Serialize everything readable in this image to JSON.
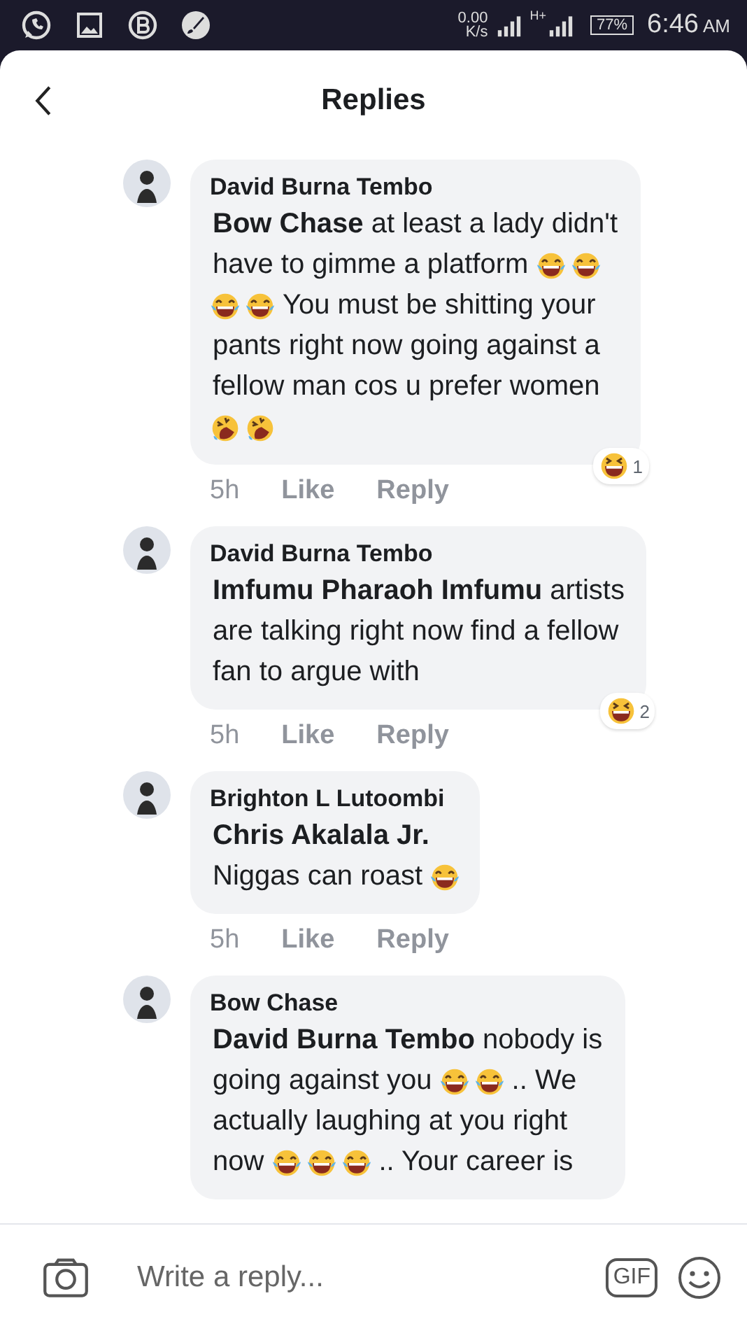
{
  "status_bar": {
    "speed": "0.00",
    "speed_unit": "K/s",
    "network": "H+",
    "battery": "77%",
    "time": "6:46",
    "ampm": "AM"
  },
  "header": {
    "title": "Replies"
  },
  "comments": [
    {
      "author": "David Burna Tembo",
      "lines": [
        [
          {
            "kind": "text",
            "text": "**Bow Chase** at least a lady didn't"
          }
        ],
        [
          {
            "kind": "text",
            "text": "have to gimme a platform"
          },
          {
            "kind": "joy"
          },
          {
            "kind": "joy"
          }
        ],
        [
          {
            "kind": "joy"
          },
          {
            "kind": "joy"
          },
          {
            "kind": "text",
            "text": "You must be shitting your"
          }
        ],
        [
          {
            "kind": "text",
            "text": "pants right now going against a"
          }
        ],
        [
          {
            "kind": "text",
            "text": "fellow man cos u prefer women"
          }
        ],
        [
          {
            "kind": "rofl"
          },
          {
            "kind": "rofl"
          }
        ]
      ],
      "time": "5h",
      "like": "Like",
      "reply": "Reply",
      "reaction_count": "1"
    },
    {
      "author": "David Burna Tembo",
      "lines": [
        [
          {
            "kind": "text",
            "text": "**Imfumu Pharaoh Imfumu** artists"
          }
        ],
        [
          {
            "kind": "text",
            "text": "are talking right now find a fellow"
          }
        ],
        [
          {
            "kind": "text",
            "text": "fan to argue with"
          }
        ]
      ],
      "time": "5h",
      "like": "Like",
      "reply": "Reply",
      "reaction_count": "2"
    },
    {
      "author": "Brighton L Lutoombi",
      "lines": [
        [
          {
            "kind": "text",
            "text": "**Chris Akalala Jr.**"
          }
        ],
        [
          {
            "kind": "text",
            "text": "Niggas can roast"
          },
          {
            "kind": "joy"
          }
        ]
      ],
      "time": "5h",
      "like": "Like",
      "reply": "Reply"
    },
    {
      "author": "Bow Chase",
      "lines": [
        [
          {
            "kind": "text",
            "text": "**David Burna Tembo** nobody is"
          }
        ],
        [
          {
            "kind": "text",
            "text": "going against you"
          },
          {
            "kind": "joy"
          },
          {
            "kind": "joy"
          },
          {
            "kind": "text",
            "text": ".. We"
          }
        ],
        [
          {
            "kind": "text",
            "text": "actually laughing at you right"
          }
        ],
        [
          {
            "kind": "text",
            "text": "now"
          },
          {
            "kind": "joy"
          },
          {
            "kind": "joy"
          },
          {
            "kind": "joy"
          },
          {
            "kind": "text",
            "text": ".. Your career is"
          }
        ]
      ]
    }
  ],
  "composer": {
    "placeholder": "Write a reply...",
    "gif": "GIF"
  }
}
